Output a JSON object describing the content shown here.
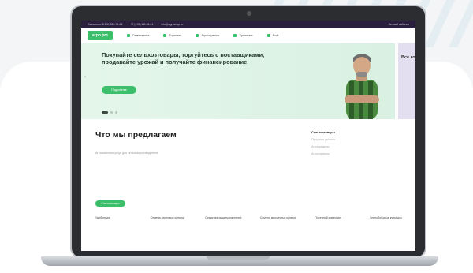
{
  "topbar": {
    "left_text": "Связаться: 8 800 555-76-24",
    "phone": "+7 (495) 111-11-11",
    "mail": "info@agroshop.ru",
    "right_text": "Личный кабинет"
  },
  "nav": {
    "logo": "агро.рф",
    "items": [
      "Семенатива",
      "Торговля",
      "Агросервисы",
      "Хранение",
      "Ещё"
    ]
  },
  "hero": {
    "title": "Покупайте сельхозтовары, торгуйтесь с поставщиками, продавайте урожай и получайте финансирование",
    "button": "Подробнее",
    "next_slide_text": "Все ком"
  },
  "offer": {
    "title": "Что мы предлагаем",
    "subtitle": "Агрокомплекс услуг для сельхозпроизводителя",
    "side_items": [
      "Сельхозтовары",
      "Продажа урожая",
      "Агрокредиты",
      "Агросервисы"
    ],
    "tag": "Сельхозтовары",
    "categories": [
      "Удобрения",
      "Семена зерновых культур",
      "Средства защиты растений",
      "Семена масличных культур",
      "Посевной материал",
      "Зернобобовые культуры"
    ]
  }
}
